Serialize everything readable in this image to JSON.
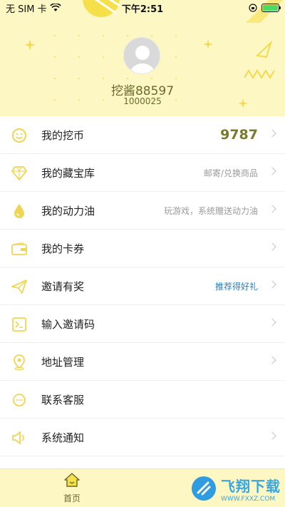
{
  "status_bar": {
    "carrier": "无 SIM 卡",
    "time": "下午2:51"
  },
  "profile": {
    "username": "挖酱88597",
    "user_id": "1000025"
  },
  "menu": [
    {
      "label": "我的挖币",
      "value": "9787",
      "icon": "smiley-icon"
    },
    {
      "label": "我的藏宝库",
      "value": "邮寄/兑换商品",
      "icon": "diamond-icon"
    },
    {
      "label": "我的动力油",
      "value": "玩游戏，系统赠送动力油",
      "icon": "oil-drop-icon"
    },
    {
      "label": "我的卡券",
      "value": "",
      "icon": "wallet-icon"
    },
    {
      "label": "邀请有奖",
      "value": "推荐得好礼",
      "icon": "paper-plane-icon"
    },
    {
      "label": "输入邀请码",
      "value": "",
      "icon": "invite-code-icon"
    },
    {
      "label": "地址管理",
      "value": "",
      "icon": "location-icon"
    },
    {
      "label": "联系客服",
      "value": "",
      "icon": "chat-icon"
    },
    {
      "label": "系统通知",
      "value": "",
      "icon": "speaker-icon"
    }
  ],
  "tabbar": {
    "home_label": "首页"
  },
  "watermark": {
    "text": "飞翔下载",
    "url": "WWW.FXXZ.COM"
  },
  "colors": {
    "header_bg": "#fdf7c4",
    "accent": "#f2d94e",
    "icon": "#f0d552",
    "blue": "#2a7fc1"
  }
}
